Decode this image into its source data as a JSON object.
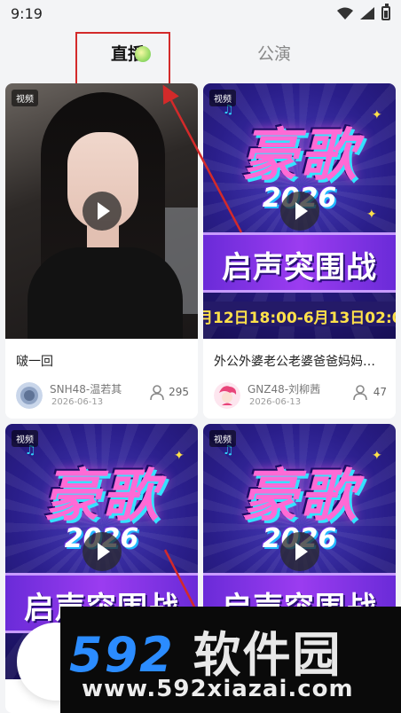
{
  "status": {
    "time": "9:19"
  },
  "tabs": [
    {
      "label": "直播",
      "active": true
    },
    {
      "label": "公演",
      "active": false
    }
  ],
  "cards": [
    {
      "badge": "视频",
      "title": "啵一回",
      "author": "SNH48-温若其",
      "date": "2026-06-13",
      "viewers": "295",
      "thumb_type": "photo"
    },
    {
      "badge": "视频",
      "title": "外公外婆老公老婆爸爸妈妈…",
      "author": "GNZ48-刘柳茜",
      "date": "2026-06-13",
      "viewers": "47",
      "thumb_type": "poster"
    },
    {
      "badge": "视频",
      "title": "",
      "author": "",
      "date": "",
      "viewers": "",
      "thumb_type": "poster"
    },
    {
      "badge": "视频",
      "title": "",
      "author": "",
      "date": "",
      "viewers": "",
      "thumb_type": "poster"
    }
  ],
  "poster": {
    "title": "豪歌",
    "year": "2026",
    "subtitle": "启声突围战",
    "date_text": "月12日18:00-6月13日02:0"
  },
  "watermark": {
    "number": "592",
    "text": "软件园",
    "url": "www.592xiazai.com"
  },
  "colors": {
    "annotation": "#d32a2a",
    "accent": "#2b8cff",
    "poster_pink": "#ff6ad5"
  }
}
